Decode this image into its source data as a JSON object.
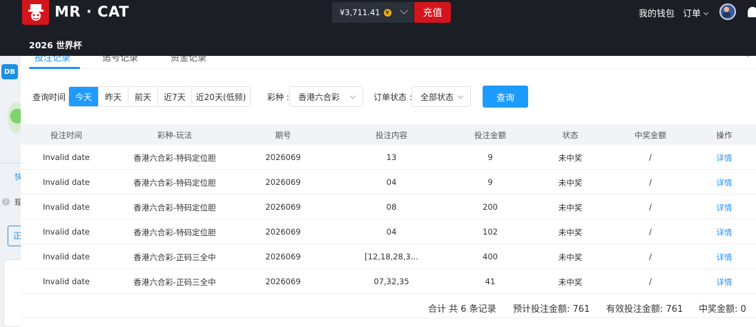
{
  "header": {
    "brand": "MR · CAT",
    "balance": "¥3,711.41",
    "coin_symbol": "¥",
    "recharge_label": "充值",
    "wallet_label": "我的钱包",
    "orders_label": "订单",
    "subnav_worldcup": "2026 世界杯",
    "brand_color": "#d4151c"
  },
  "tabs": [
    "投注记录",
    "追号记录",
    "资金记录"
  ],
  "left": {
    "badge": "DB",
    "kuai": "快",
    "zhen": "现",
    "btn": "正"
  },
  "filters": {
    "time_label": "查询时间 :",
    "time_options": [
      "今天",
      "昨天",
      "前天",
      "近7天",
      "近20天(低频)"
    ],
    "time_selected": "今天",
    "lottery_label": "彩种 :",
    "lottery_value": "香港六合彩",
    "status_label": "订单状态 :",
    "status_value": "全部状态",
    "query_label": "查询"
  },
  "table": {
    "columns": [
      "投注时间",
      "彩种-玩法",
      "期号",
      "投注内容",
      "投注金额",
      "状态",
      "中奖金额",
      "操作"
    ],
    "rows": [
      [
        "Invalid date",
        "香港六合彩-特码定位胆",
        "2026069",
        "13",
        "9",
        "未中奖",
        "/",
        "详情"
      ],
      [
        "Invalid date",
        "香港六合彩-特码定位胆",
        "2026069",
        "04",
        "9",
        "未中奖",
        "/",
        "详情"
      ],
      [
        "Invalid date",
        "香港六合彩-特码定位胆",
        "2026069",
        "08",
        "200",
        "未中奖",
        "/",
        "详情"
      ],
      [
        "Invalid date",
        "香港六合彩-特码定位胆",
        "2026069",
        "04",
        "102",
        "未中奖",
        "/",
        "详情"
      ],
      [
        "Invalid date",
        "香港六合彩-正码三全中",
        "2026069",
        "[12,18,28,3...",
        "400",
        "未中奖",
        "/",
        "详情"
      ],
      [
        "Invalid date",
        "香港六合彩-正码三全中",
        "2026069",
        "07,32,35",
        "41",
        "未中奖",
        "/",
        "详情"
      ]
    ]
  },
  "summary": {
    "total": "合计 共 6 条记录",
    "expected": "预计投注金额: 761",
    "valid": "有效投注金额: 761",
    "win": "中奖金额: 0"
  }
}
